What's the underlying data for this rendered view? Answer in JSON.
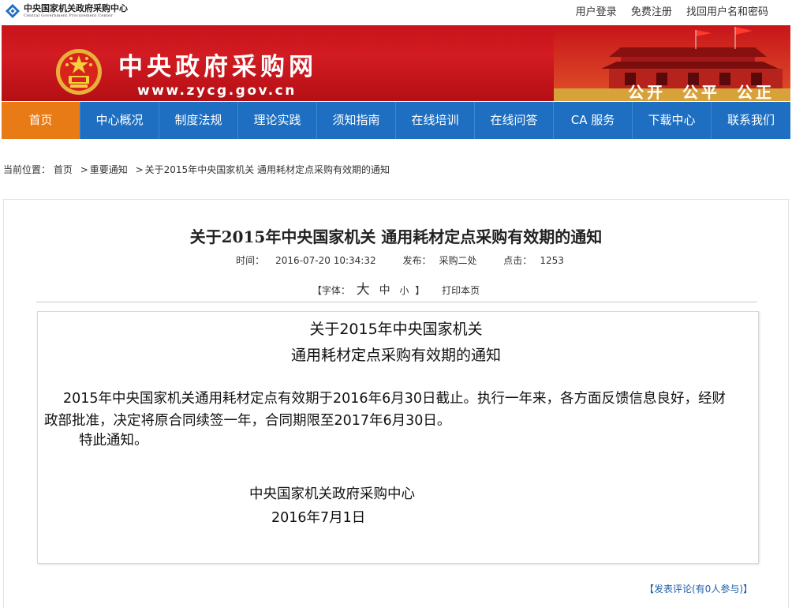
{
  "header": {
    "logo_cn": "中央国家机关政府采购中心",
    "logo_en": "Central Government Procurement Center",
    "links": [
      "用户登录",
      "免费注册",
      "找回用户名和密码"
    ]
  },
  "banner": {
    "title": "中央政府采购网",
    "url": "www.zycg.gov.cn",
    "slogan": [
      "公开",
      "公平",
      "公正"
    ]
  },
  "nav": {
    "items": [
      "首页",
      "中心概况",
      "制度法规",
      "理论实践",
      "须知指南",
      "在线培训",
      "在线问答",
      "CA 服务",
      "下载中心",
      "联系我们"
    ],
    "active_index": 0
  },
  "breadcrumb": {
    "prefix": "当前位置：",
    "items": [
      "首页",
      "重要通知",
      "关于2015年中央国家机关 通用耗材定点采购有效期的通知"
    ]
  },
  "article": {
    "title": "关于2015年中央国家机关 通用耗材定点采购有效期的通知",
    "time_label": "时间：",
    "time": "2016-07-20 10:34:32",
    "publisher_label": "发布：",
    "publisher": "采购二处",
    "clicks_label": "点击：",
    "clicks": "1253",
    "font_prefix": "【字体：",
    "font_big": "大",
    "font_mid": "中",
    "font_small": "小",
    "font_suffix": "】",
    "print": "打印本页"
  },
  "content": {
    "title_line1": "关于2015年中央国家机关",
    "title_line2": "通用耗材定点采购有效期的通知",
    "paragraph": "2015年中央国家机关通用耗材定点有效期于2016年6月30日截止。执行一年来，各方面反馈信息良好，经财政部批准，决定将原合同续签一年，合同期限至2017年6月30日。",
    "notice": "特此通知。",
    "sign_org": "中央国家机关政府采购中心",
    "sign_date": "2016年7月1日"
  },
  "comment": {
    "label": "【发表评论(有0人参与)】"
  },
  "colors": {
    "banner_red": "#c8141a",
    "nav_blue": "#1e6fc1",
    "nav_active": "#e87b15",
    "link_blue": "#1e5fa8"
  }
}
